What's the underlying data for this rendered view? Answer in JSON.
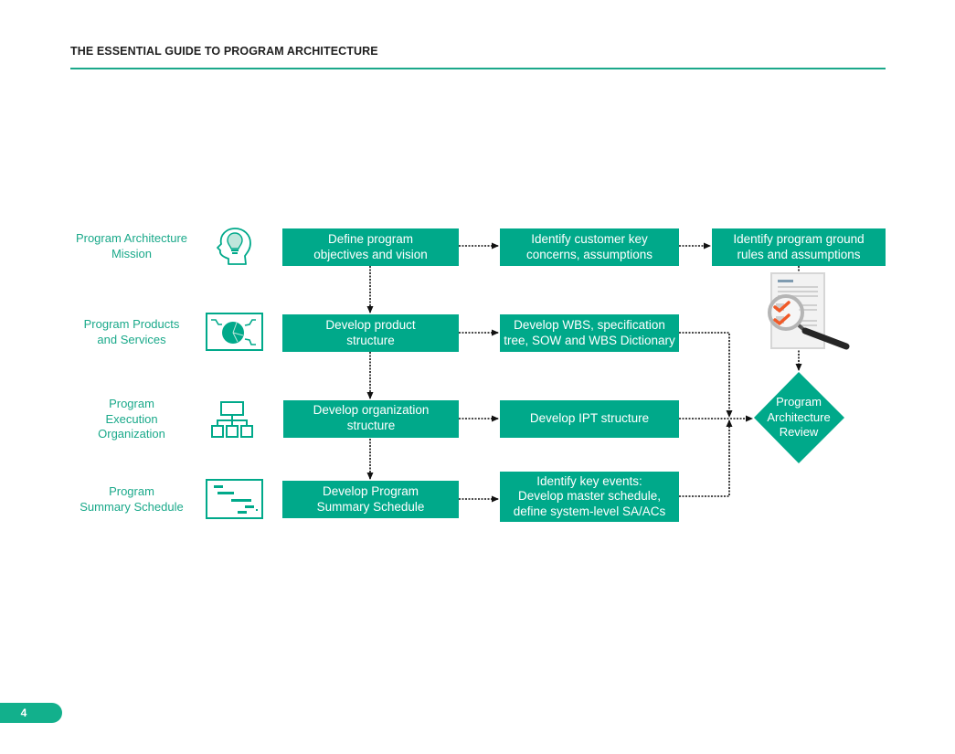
{
  "header": {
    "title": "THE ESSENTIAL GUIDE TO PROGRAM ARCHITECTURE"
  },
  "colors": {
    "accent": "#00a98a",
    "label_text": "#1aa98a",
    "connector": "#111111",
    "check": "#f05a28"
  },
  "rows": [
    {
      "label_lines": [
        "Program Architecture",
        "Mission"
      ],
      "icon": "head-lightbulb-icon",
      "step_lines": [
        "Define program",
        "objectives and vision"
      ],
      "detail_lines": [
        "Identify customer key",
        "concerns, assumptions"
      ]
    },
    {
      "label_lines": [
        "Program Products",
        "and Services"
      ],
      "icon": "pie-chart-presentation-icon",
      "step_lines": [
        "Develop product",
        "structure"
      ],
      "detail_lines": [
        "Develop WBS, specification",
        "tree, SOW and WBS Dictionary"
      ]
    },
    {
      "label_lines": [
        "Program",
        "Execution",
        "Organization"
      ],
      "icon": "org-chart-icon",
      "step_lines": [
        "Develop organization",
        "structure"
      ],
      "detail_lines": [
        "Develop IPT structure"
      ]
    },
    {
      "label_lines": [
        "Program",
        "Summary Schedule"
      ],
      "icon": "gantt-schedule-icon",
      "step_lines": [
        "Develop Program",
        "Summary Schedule"
      ],
      "detail_lines": [
        "Identify key events:",
        "Develop master schedule,",
        "define system-level SA/ACs"
      ]
    }
  ],
  "ground_rules_box": {
    "lines": [
      "Identify program ground",
      "rules and assumptions"
    ],
    "icon": "document-magnifier-checklist-icon"
  },
  "review": {
    "lines": [
      "Program",
      "Architecture",
      "Review"
    ],
    "shape": "diamond"
  },
  "footer": {
    "page_number": "4"
  }
}
